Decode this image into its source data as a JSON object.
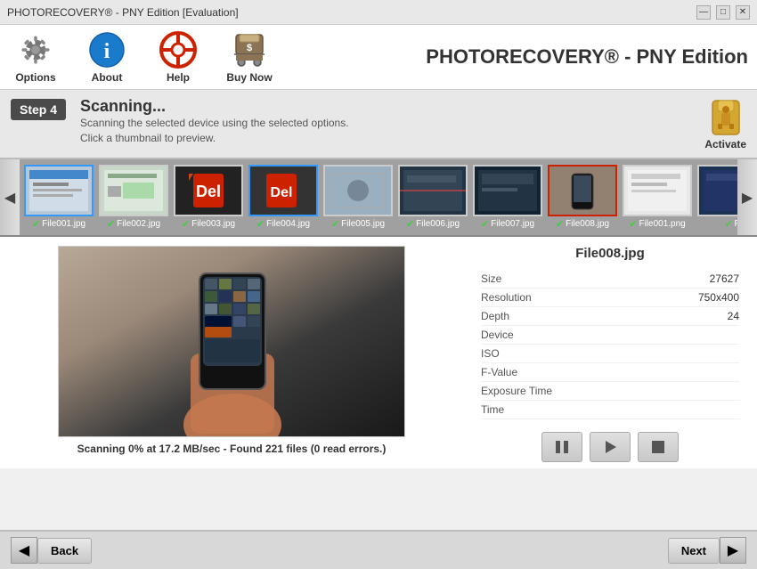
{
  "titlebar": {
    "title": "PHOTORECOVERY® - PNY Edition [Evaluation]",
    "minimize_label": "—",
    "maximize_label": "□",
    "close_label": "✕"
  },
  "toolbar": {
    "options_label": "Options",
    "about_label": "About",
    "help_label": "Help",
    "buynow_label": "Buy Now",
    "app_title": "PHOTORECOVERY® - PNY Edition"
  },
  "step": {
    "badge": "Step 4",
    "heading": "Scanning...",
    "description1": "Scanning the selected device using the selected options.",
    "description2": "Click a thumbnail to preview.",
    "activate_label": "Activate"
  },
  "thumbnails": [
    {
      "label": "File001.jpg",
      "bg": "thumb-bg-1",
      "selected": false,
      "highlighted": true
    },
    {
      "label": "File002.jpg",
      "bg": "thumb-bg-2",
      "selected": false,
      "highlighted": false
    },
    {
      "label": "File003.jpg",
      "bg": "thumb-bg-3",
      "selected": false,
      "highlighted": false
    },
    {
      "label": "File004.jpg",
      "bg": "thumb-bg-4",
      "selected": false,
      "highlighted": true
    },
    {
      "label": "File005.jpg",
      "bg": "thumb-bg-5",
      "selected": false,
      "highlighted": false
    },
    {
      "label": "File006.jpg",
      "bg": "thumb-bg-6",
      "selected": false,
      "highlighted": false
    },
    {
      "label": "File007.jpg",
      "bg": "thumb-bg-7",
      "selected": false,
      "highlighted": false
    },
    {
      "label": "File008.jpg",
      "bg": "thumb-bg-8",
      "selected": true,
      "highlighted": false
    },
    {
      "label": "File001.png",
      "bg": "thumb-bg-9",
      "selected": false,
      "highlighted": false
    },
    {
      "label": "F",
      "bg": "thumb-bg-10",
      "selected": false,
      "highlighted": false
    }
  ],
  "preview": {
    "status": "Scanning 0% at 17.2 MB/sec - Found 221 files (0 read errors.)"
  },
  "file_info": {
    "title": "File008.jpg",
    "fields": [
      {
        "label": "Size",
        "value": "27627"
      },
      {
        "label": "Resolution",
        "value": "750x400"
      },
      {
        "label": "Depth",
        "value": "24"
      },
      {
        "label": "Device",
        "value": ""
      },
      {
        "label": "ISO",
        "value": ""
      },
      {
        "label": "F-Value",
        "value": ""
      },
      {
        "label": "Exposure Time",
        "value": ""
      },
      {
        "label": "Time",
        "value": ""
      }
    ]
  },
  "bottom_nav": {
    "back_label": "Back",
    "next_label": "Next"
  }
}
